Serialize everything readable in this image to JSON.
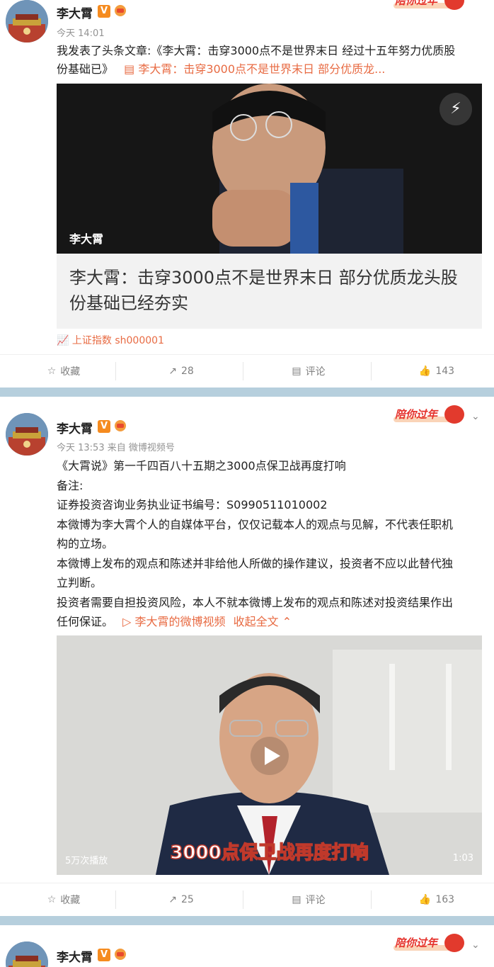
{
  "posts": [
    {
      "author": "李大霄",
      "verified_badge": "V",
      "time": "今天 14:01",
      "festival_badge": "陪你过年",
      "text_line1": "我发表了头条文章:《李大霄：击穿3000点不是世界末日 经过十五年努力优质股",
      "text_line2_prefix": "份基础已》",
      "article_link": "李大霄：击穿3000点不是世界末日 部分优质龙...",
      "article": {
        "photo_name": "李大霄",
        "title": "李大霄：击穿3000点不是世界末日 部分优质龙头股份基础已经夯实"
      },
      "stock_tag": "上证指数 sh000001",
      "actions": {
        "favorite": "收藏",
        "repost": "28",
        "comment": "评论",
        "like": "143"
      }
    },
    {
      "author": "李大霄",
      "verified_badge": "V",
      "time": "今天 13:53 来自 微博视频号",
      "festival_badge": "陪你过年",
      "lines": [
        "《大霄说》第一千四百八十五期之3000点保卫战再度打响",
        "备注:",
        "证券投资咨询业务执业证书编号：S0990511010002",
        "本微博为李大霄个人的自媒体平台，仅仅记载本人的观点与见解，不代表任职机",
        "构的立场。",
        "本微博上发布的观点和陈述并非给他人所做的操作建议，投资者不应以此替代独",
        "立判断。",
        "投资者需要自担投资风险，本人不就本微博上发布的观点和陈述对投资结果作出"
      ],
      "last_line_prefix": "任何保证。",
      "video_link": "李大霄的微博视频",
      "collapse_link": "收起全文",
      "video": {
        "views": "5万次播放",
        "duration": "1:03",
        "caption": "3000点保卫战再度打响"
      },
      "actions": {
        "favorite": "收藏",
        "repost": "25",
        "comment": "评论",
        "like": "163"
      }
    },
    {
      "author": "李大霄",
      "verified_badge": "V",
      "festival_badge": "陪你过年"
    }
  ],
  "colors": {
    "accent": "#e86b43",
    "badge": "#f58b1f",
    "separator": "#b6cfdd"
  }
}
